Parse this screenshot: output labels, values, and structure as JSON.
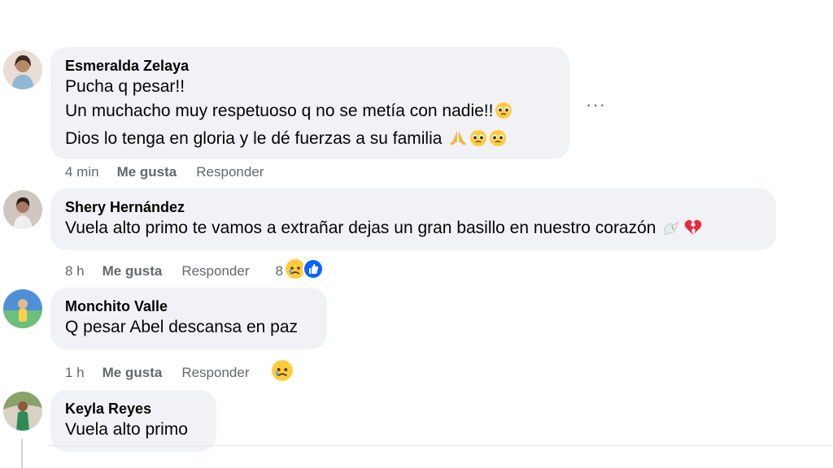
{
  "comments": [
    {
      "author": "Esmeralda Zelaya",
      "lines": [
        "Pucha q pesar!!",
        "Un muchacho muy respetuoso q no se metía con nadie!!",
        "Dios lo tenga en gloria y le dé fuerzas a su familia"
      ],
      "time": "4 min",
      "like_label": "Me gusta",
      "reply_label": "Responder",
      "emojis": [
        "pleading-face",
        "folded-hands",
        "pleading-face",
        "pleading-face"
      ]
    },
    {
      "author": "Shery Hernández",
      "lines": [
        "Vuela alto primo te vamos a extrañar dejas un gran basillo en nuestro corazón"
      ],
      "time": "8 h",
      "like_label": "Me gusta",
      "reply_label": "Responder",
      "reaction_count": "8",
      "reactions": [
        "sad-reaction",
        "like-reaction"
      ],
      "emojis": [
        "dove",
        "broken-heart"
      ]
    },
    {
      "author": "Monchito Valle",
      "lines": [
        "Q pesar Abel descansa en paz"
      ],
      "time": "1 h",
      "like_label": "Me gusta",
      "reply_label": "Responder",
      "reactions": [
        "sad-reaction"
      ]
    },
    {
      "author": "Keyla Reyes",
      "lines": [
        "Vuela alto primo"
      ]
    }
  ],
  "more_options": "···",
  "colors": {
    "bubble": "#f0f2f5",
    "meta_text": "#65676b",
    "like_blue": "#0866ff",
    "broken_heart": "#e8283c",
    "emoji_yellow": "#ffcc3d"
  }
}
